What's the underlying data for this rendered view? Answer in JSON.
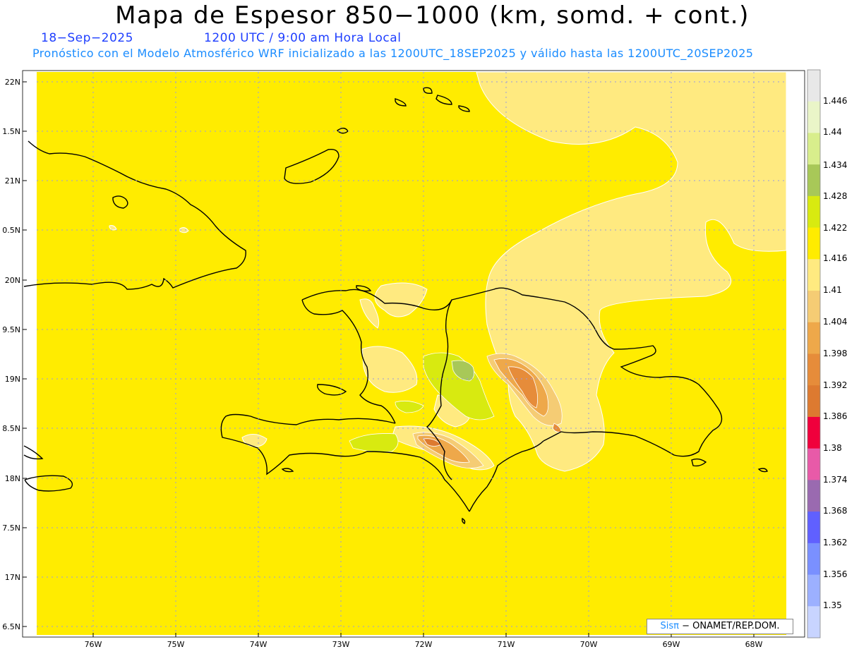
{
  "header": {
    "title": "Mapa de Espesor 850−1000 (km, somd. + cont.)",
    "date": "18−Sep−2025",
    "time": "1200 UTC / 9:00 am Hora Local",
    "subtitle": "Pronóstico con el Modelo Atmosférico WRF inicializado a las 1200UTC_18SEP2025 y válido hasta las  1200UTC_20SEP2025"
  },
  "axes": {
    "lat_labels": [
      "22N",
      "1.5N",
      "21N",
      "0.5N",
      "20N",
      "9.5N",
      "19N",
      "8.5N",
      "18N",
      "7.5N",
      "17N",
      "6.5N"
    ],
    "lon_labels": [
      "76W",
      "75W",
      "74W",
      "73W",
      "72W",
      "71W",
      "70W",
      "69W",
      "68W"
    ]
  },
  "colorbar": {
    "labels": [
      "1.446",
      "1.44",
      "1.434",
      "1.428",
      "1.422",
      "1.416",
      "1.41",
      "1.404",
      "1.398",
      "1.392",
      "1.386",
      "1.38",
      "1.374",
      "1.368",
      "1.362",
      "1.356",
      "1.35"
    ],
    "colors": [
      "#e8e8e8",
      "#eaf5c8",
      "#d8ee8c",
      "#a8c858",
      "#d8ea10",
      "#ffec00",
      "#ffea80",
      "#f5cc74",
      "#eea84a",
      "#e68c3a",
      "#dd7a30",
      "#f0003c",
      "#e85aa8",
      "#9a6ab0",
      "#6060ff",
      "#7a90ff",
      "#9cb0ff",
      "#c8d4ff"
    ]
  },
  "credit": {
    "brand": "Sis",
    "pi": "π",
    "text": " − ONAMET/REP.DOM."
  },
  "colors": {
    "background_field": "#ffec00",
    "light_contour": "#ffea80",
    "coastline": "#000000"
  }
}
